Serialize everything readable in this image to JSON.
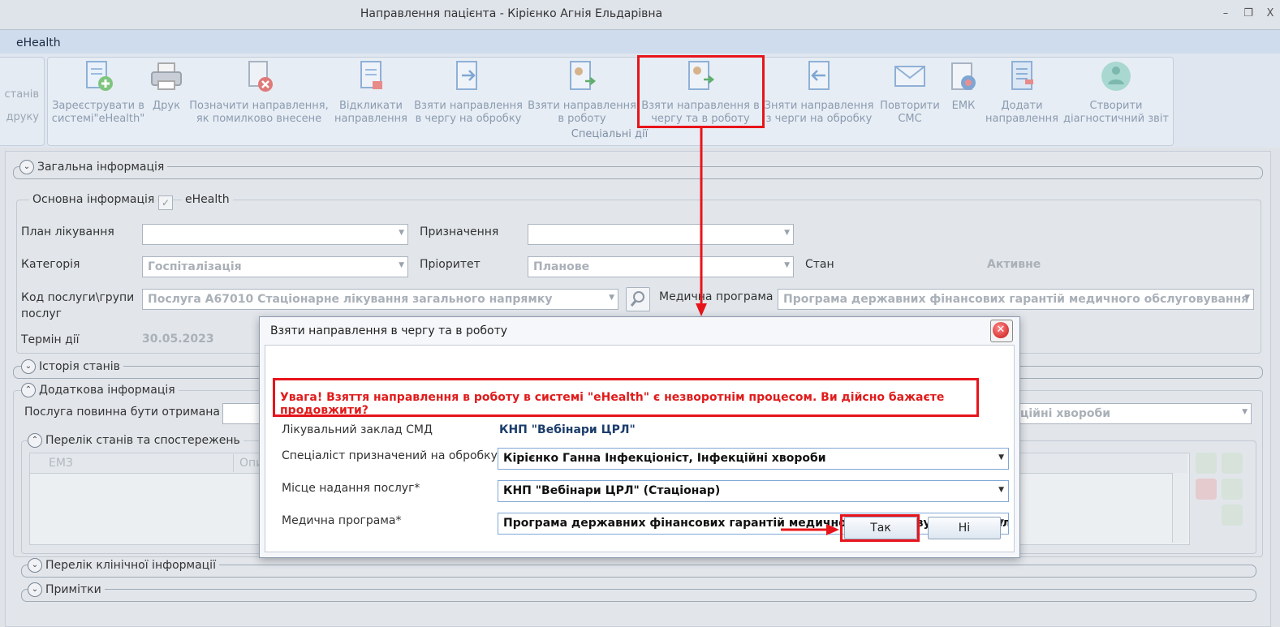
{
  "window": {
    "title": "Направлення пацієнта - Кірієнко Агнія Ельдарівна",
    "minimize": "–",
    "restore": "❐",
    "close": "X"
  },
  "menu": {
    "item": "eHealth"
  },
  "ribbon": {
    "left_labels": [
      "станів",
      "друку"
    ],
    "group_label": "Спеціальні дії",
    "buttons": [
      {
        "label": "Зареєструвати в\nсистемі\"eHealth\"",
        "icon": "register-icon"
      },
      {
        "label": "Друк",
        "icon": "printer-icon"
      },
      {
        "label": "Позначити направлення,\nяк помилково внесене",
        "icon": "mark-error-icon"
      },
      {
        "label": "Відкликати\nнаправлення",
        "icon": "revoke-icon"
      },
      {
        "label": "Взяти направлення\nв чергу на обробку",
        "icon": "queue-icon"
      },
      {
        "label": "Взяти направлення\nв роботу",
        "icon": "take-work-icon"
      },
      {
        "label": "Взяти направлення в\nчергу та в роботу",
        "icon": "queue-work-icon"
      },
      {
        "label": "Зняти направлення\nз черги на обробку",
        "icon": "remove-queue-icon"
      },
      {
        "label": "Повторити\nСМС",
        "icon": "sms-icon"
      },
      {
        "label": "ЕМК",
        "icon": "emk-icon"
      },
      {
        "label": "Додати\nнаправлення",
        "icon": "add-referral-icon"
      },
      {
        "label": "Створити\nдіагностичний звіт",
        "icon": "diag-report-icon"
      }
    ]
  },
  "form": {
    "general_section": "Загальна інформація",
    "basic_info_label": "Основна інформація",
    "ehealth_label": "eHealth",
    "plan_label": "План лікування",
    "purpose_label": "Призначення",
    "category_label": "Категорія",
    "category_value": "Госпіталізація",
    "priority_label": "Пріоритет",
    "priority_value": "Планове",
    "status_label": "Стан",
    "status_value": "Активне",
    "service_label": "Код послуги\\групи\nпослуг",
    "service_value": "Послуга A67010 Стаціонарне лікування загального напрямку",
    "med_program_label": "Медична програма",
    "med_program_value": "Програма державних фінансових гарантій медичного обслуговування насел",
    "term_label": "Термін дії",
    "term_value": "30.05.2023",
    "history_section": "Історія станів",
    "additional_section": "Додаткова інформація",
    "service_from_label": "Послуга повинна бути отримана з",
    "right_value": "ційні хвороби",
    "observations_section": "Перелік станів та спостережень",
    "grid_col_emz": "ЕМЗ",
    "grid_col_op": "Опи",
    "clinical_section": "Перелік клінічної інформації",
    "notes_section": "Примітки"
  },
  "dialog": {
    "title": "Взяти направлення в чергу та в роботу",
    "warning": "Увага! Взяття направлення в роботу в системі \"eHealth\" є незворотнім процесом. Ви дійсно бажаєте продовжити?",
    "facility_label": "Лікувальний заклад СМД",
    "facility_value": "КНП \"Вебінари ЦРЛ\"",
    "specialist_label": "Спеціаліст призначений на обробку*",
    "specialist_value": "Кірієнко Ганна Інфекціоніст, Інфекційні хвороби",
    "place_label": "Місце надання послуг*",
    "place_value": "КНП \"Вебінари ЦРЛ\" (Стаціонар)",
    "program_label": "Медична програма*",
    "program_value": "Програма державних фінансових гарантій медичного обслуговування населення",
    "yes_button": "Так",
    "no_button": "Ні"
  },
  "colors": {
    "annotation": "#e8141b",
    "accent": "#1c3d6b"
  }
}
